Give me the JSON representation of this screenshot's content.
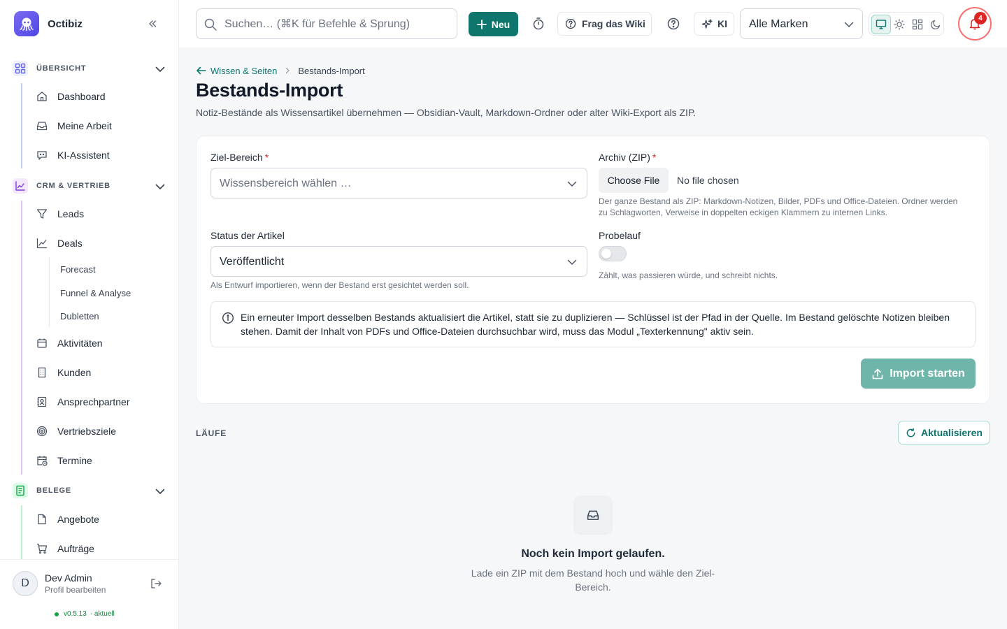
{
  "app": {
    "name": "Octibiz"
  },
  "sidebar": {
    "sections": [
      {
        "label": "ÜBERSICHT",
        "items": [
          "Dashboard",
          "Meine Arbeit",
          "KI-Assistent"
        ]
      },
      {
        "label": "CRM & VERTRIEB",
        "items": [
          "Leads",
          "Deals",
          "Aktivitäten",
          "Kunden",
          "Ansprechpartner",
          "Vertriebsziele",
          "Termine"
        ],
        "deals_subitems": [
          "Forecast",
          "Funnel & Analyse",
          "Dubletten"
        ]
      },
      {
        "label": "BELEGE",
        "items": [
          "Angebote",
          "Aufträge"
        ]
      }
    ],
    "profile": {
      "initial": "D",
      "name": "Dev Admin",
      "sub": "Profil bearbeiten"
    },
    "version": {
      "number": "v0.5.13",
      "status": "· aktuell"
    }
  },
  "topbar": {
    "search_placeholder": "Suchen… (⌘K für Befehle & Sprung)",
    "new_label": "Neu",
    "wiki_label": "Frag das Wiki",
    "ki_label": "KI",
    "brand_select": "Alle Marken",
    "notifications_count": "4"
  },
  "breadcrumb": {
    "parent": "Wissen & Seiten",
    "current": "Bestands-Import"
  },
  "page": {
    "title": "Bestands-Import",
    "description": "Notiz-Bestände als Wissensartikel übernehmen — Obsidian-Vault, Markdown-Ordner oder alter Wiki-Export als ZIP."
  },
  "form": {
    "target": {
      "label": "Ziel-Bereich",
      "required": "*",
      "placeholder": "Wissensbereich wählen …"
    },
    "archive": {
      "label": "Archiv (ZIP)",
      "required": "*",
      "button": "Choose File",
      "no_file": "No file chosen",
      "hint": "Der ganze Bestand als ZIP: Markdown-Notizen, Bilder, PDFs und Office-Dateien. Ordner werden zu Schlagworten, Verweise in doppelten eckigen Klammern zu internen Links."
    },
    "status": {
      "label": "Status der Artikel",
      "value": "Veröffentlicht",
      "hint": "Als Entwurf importieren, wenn der Bestand erst gesichtet werden soll."
    },
    "dry_run": {
      "label": "Probelauf",
      "enabled": false,
      "hint": "Zählt, was passieren würde, und schreibt nichts."
    },
    "info": "Ein erneuter Import desselben Bestands aktualisiert die Artikel, statt sie zu duplizieren — Schlüssel ist der Pfad in der Quelle. Im Bestand gelöschte Notizen bleiben stehen. Damit der Inhalt von PDFs und Office-Dateien durchsuchbar wird, muss das Modul „Texterkennung\" aktiv sein.",
    "submit_label": "Import starten"
  },
  "runs": {
    "label": "LÄUFE",
    "refresh_label": "Aktualisieren",
    "empty_title": "Noch kein Import gelaufen.",
    "empty_sub": "Lade ein ZIP mit dem Bestand hoch und wähle den Ziel-Bereich."
  },
  "colors": {
    "accent": "#0f766e",
    "accent_disabled": "#6fb5a9",
    "danger": "#dc2626",
    "section_overview": "#6366f1",
    "section_crm": "#7c3aed",
    "section_belege": "#16a34a"
  }
}
